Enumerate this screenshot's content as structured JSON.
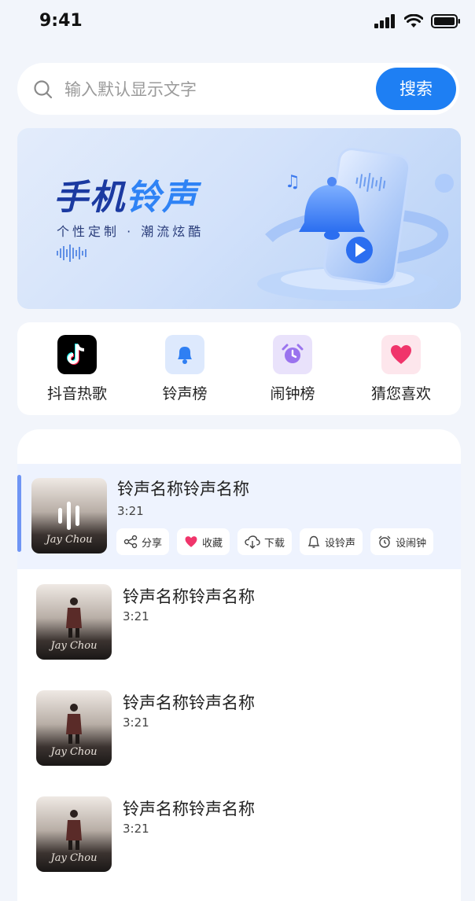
{
  "status": {
    "time": "9:41"
  },
  "search": {
    "placeholder": "输入默认显示文字",
    "button": "搜索"
  },
  "banner": {
    "title_part1": "手机",
    "title_part2": "铃声",
    "subtitle": "个性定制 · 潮流炫酷"
  },
  "quick": [
    {
      "label": "抖音热歌",
      "icon": "tiktok-icon"
    },
    {
      "label": "铃声榜",
      "icon": "bell-icon"
    },
    {
      "label": "闹钟榜",
      "icon": "alarm-clock-icon"
    },
    {
      "label": "猜您喜欢",
      "icon": "heart-icon"
    }
  ],
  "songs": [
    {
      "title": "铃声名称铃声名称",
      "duration": "3:21",
      "cover_text": "Jay Chou"
    },
    {
      "title": "铃声名称铃声名称",
      "duration": "3:21",
      "cover_text": "Jay Chou"
    },
    {
      "title": "铃声名称铃声名称",
      "duration": "3:21",
      "cover_text": "Jay Chou"
    },
    {
      "title": "铃声名称铃声名称",
      "duration": "3:21",
      "cover_text": "Jay Chou"
    }
  ],
  "actions": [
    "分享",
    "收藏",
    "下载",
    "设铃声",
    "设闹钟"
  ],
  "colors": {
    "accent": "#1e7ff3",
    "active_row": "#eef3fe",
    "active_bar": "#6f95f4",
    "heart": "#f0356b"
  }
}
